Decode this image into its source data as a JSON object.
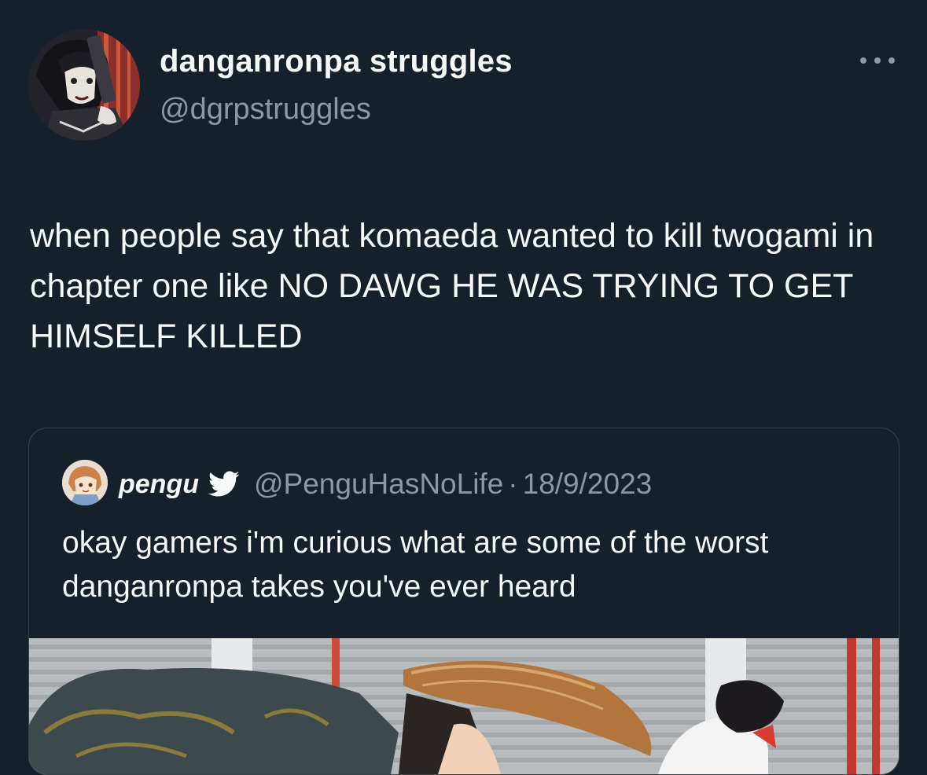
{
  "tweet": {
    "author": {
      "display_name": "danganronpa struggles",
      "handle": "@dgrpstruggles",
      "avatar_icon": "profile-avatar"
    },
    "more_icon": "more-options-icon",
    "text": "when people say that komaeda wanted to kill twogami in chapter one like NO DAWG HE WAS TRYING TO GET HIMSELF KILLED"
  },
  "quote": {
    "author": {
      "display_name": "pengu",
      "handle": "@PenguHasNoLife",
      "verified_icon": "twitter-bird-icon"
    },
    "separator": "·",
    "date": "18/9/2023",
    "text": "okay gamers i'm curious what are some of the worst danganronpa takes you've ever heard",
    "media": "anime-screenshot"
  },
  "colors": {
    "background": "#15202b",
    "text": "#f7f9f9",
    "secondary_text": "#8b98a5",
    "border": "#38444d",
    "verified": "#1d9bf0"
  }
}
